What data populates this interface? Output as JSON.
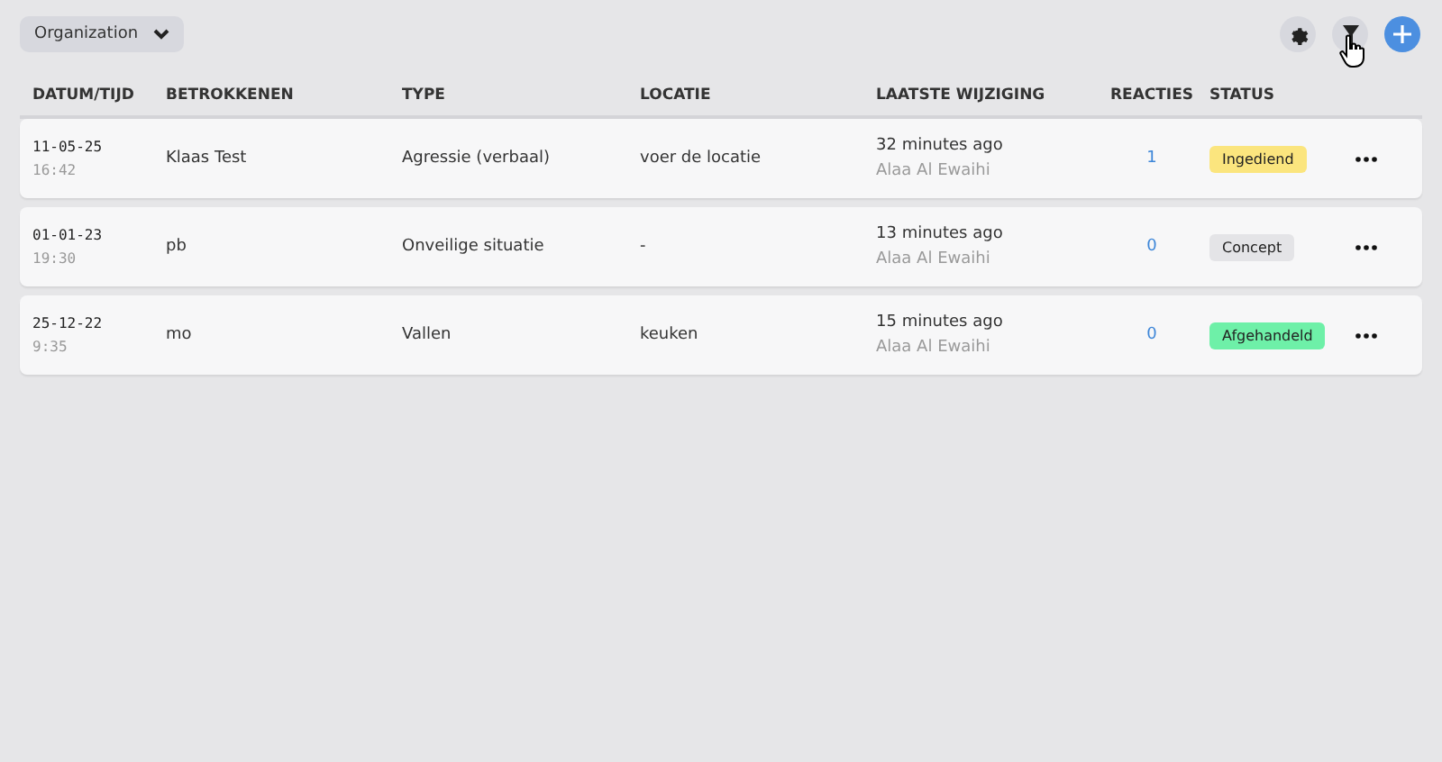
{
  "organization_select": {
    "label": "Organization"
  },
  "table": {
    "columns": [
      "DATUM/TIJD",
      "BETROKKENEN",
      "TYPE",
      "LOCATIE",
      "LAATSTE WIJZIGING",
      "REACTIES",
      "STATUS"
    ],
    "rows": [
      {
        "date": "11-05-25",
        "time": "16:42",
        "betrokkenen": "Klaas Test",
        "type": "Agressie (verbaal)",
        "locatie": "voer de locatie",
        "modified": "32 minutes ago",
        "modified_by": "Alaa Al Ewaihi",
        "reacties": "1",
        "status": {
          "label": "Ingediend",
          "color": "#fbe57e"
        }
      },
      {
        "date": "01-01-23",
        "time": "19:30",
        "betrokkenen": "pb",
        "type": "Onveilige situatie",
        "locatie": "-",
        "modified": "13 minutes ago",
        "modified_by": "Alaa Al Ewaihi",
        "reacties": "0",
        "status": {
          "label": "Concept",
          "color": "#e4e4e7"
        }
      },
      {
        "date": "25-12-22",
        "time": "9:35",
        "betrokkenen": "mo",
        "type": "Vallen",
        "locatie": "keuken",
        "modified": "15 minutes ago",
        "modified_by": "Alaa Al Ewaihi",
        "reacties": "0",
        "status": {
          "label": "Afgehandeld",
          "color": "#6ef0a8"
        }
      }
    ]
  }
}
